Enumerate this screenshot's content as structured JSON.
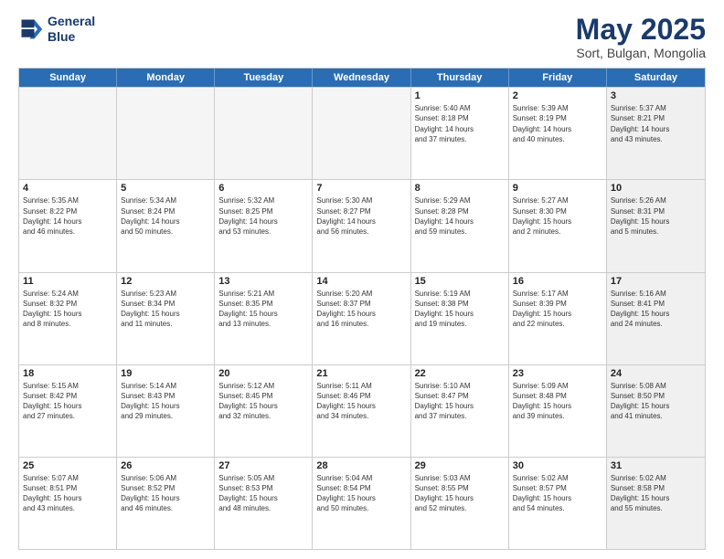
{
  "logo": {
    "line1": "General",
    "line2": "Blue"
  },
  "title": "May 2025",
  "subtitle": "Sort, Bulgan, Mongolia",
  "headers": [
    "Sunday",
    "Monday",
    "Tuesday",
    "Wednesday",
    "Thursday",
    "Friday",
    "Saturday"
  ],
  "rows": [
    [
      {
        "day": "",
        "lines": [],
        "empty": true
      },
      {
        "day": "",
        "lines": [],
        "empty": true
      },
      {
        "day": "",
        "lines": [],
        "empty": true
      },
      {
        "day": "",
        "lines": [],
        "empty": true
      },
      {
        "day": "1",
        "lines": [
          "Sunrise: 5:40 AM",
          "Sunset: 8:18 PM",
          "Daylight: 14 hours",
          "and 37 minutes."
        ],
        "empty": false,
        "shaded": false
      },
      {
        "day": "2",
        "lines": [
          "Sunrise: 5:39 AM",
          "Sunset: 8:19 PM",
          "Daylight: 14 hours",
          "and 40 minutes."
        ],
        "empty": false,
        "shaded": false
      },
      {
        "day": "3",
        "lines": [
          "Sunrise: 5:37 AM",
          "Sunset: 8:21 PM",
          "Daylight: 14 hours",
          "and 43 minutes."
        ],
        "empty": false,
        "shaded": true
      }
    ],
    [
      {
        "day": "4",
        "lines": [
          "Sunrise: 5:35 AM",
          "Sunset: 8:22 PM",
          "Daylight: 14 hours",
          "and 46 minutes."
        ],
        "empty": false,
        "shaded": false
      },
      {
        "day": "5",
        "lines": [
          "Sunrise: 5:34 AM",
          "Sunset: 8:24 PM",
          "Daylight: 14 hours",
          "and 50 minutes."
        ],
        "empty": false,
        "shaded": false
      },
      {
        "day": "6",
        "lines": [
          "Sunrise: 5:32 AM",
          "Sunset: 8:25 PM",
          "Daylight: 14 hours",
          "and 53 minutes."
        ],
        "empty": false,
        "shaded": false
      },
      {
        "day": "7",
        "lines": [
          "Sunrise: 5:30 AM",
          "Sunset: 8:27 PM",
          "Daylight: 14 hours",
          "and 56 minutes."
        ],
        "empty": false,
        "shaded": false
      },
      {
        "day": "8",
        "lines": [
          "Sunrise: 5:29 AM",
          "Sunset: 8:28 PM",
          "Daylight: 14 hours",
          "and 59 minutes."
        ],
        "empty": false,
        "shaded": false
      },
      {
        "day": "9",
        "lines": [
          "Sunrise: 5:27 AM",
          "Sunset: 8:30 PM",
          "Daylight: 15 hours",
          "and 2 minutes."
        ],
        "empty": false,
        "shaded": false
      },
      {
        "day": "10",
        "lines": [
          "Sunrise: 5:26 AM",
          "Sunset: 8:31 PM",
          "Daylight: 15 hours",
          "and 5 minutes."
        ],
        "empty": false,
        "shaded": true
      }
    ],
    [
      {
        "day": "11",
        "lines": [
          "Sunrise: 5:24 AM",
          "Sunset: 8:32 PM",
          "Daylight: 15 hours",
          "and 8 minutes."
        ],
        "empty": false,
        "shaded": false
      },
      {
        "day": "12",
        "lines": [
          "Sunrise: 5:23 AM",
          "Sunset: 8:34 PM",
          "Daylight: 15 hours",
          "and 11 minutes."
        ],
        "empty": false,
        "shaded": false
      },
      {
        "day": "13",
        "lines": [
          "Sunrise: 5:21 AM",
          "Sunset: 8:35 PM",
          "Daylight: 15 hours",
          "and 13 minutes."
        ],
        "empty": false,
        "shaded": false
      },
      {
        "day": "14",
        "lines": [
          "Sunrise: 5:20 AM",
          "Sunset: 8:37 PM",
          "Daylight: 15 hours",
          "and 16 minutes."
        ],
        "empty": false,
        "shaded": false
      },
      {
        "day": "15",
        "lines": [
          "Sunrise: 5:19 AM",
          "Sunset: 8:38 PM",
          "Daylight: 15 hours",
          "and 19 minutes."
        ],
        "empty": false,
        "shaded": false
      },
      {
        "day": "16",
        "lines": [
          "Sunrise: 5:17 AM",
          "Sunset: 8:39 PM",
          "Daylight: 15 hours",
          "and 22 minutes."
        ],
        "empty": false,
        "shaded": false
      },
      {
        "day": "17",
        "lines": [
          "Sunrise: 5:16 AM",
          "Sunset: 8:41 PM",
          "Daylight: 15 hours",
          "and 24 minutes."
        ],
        "empty": false,
        "shaded": true
      }
    ],
    [
      {
        "day": "18",
        "lines": [
          "Sunrise: 5:15 AM",
          "Sunset: 8:42 PM",
          "Daylight: 15 hours",
          "and 27 minutes."
        ],
        "empty": false,
        "shaded": false
      },
      {
        "day": "19",
        "lines": [
          "Sunrise: 5:14 AM",
          "Sunset: 8:43 PM",
          "Daylight: 15 hours",
          "and 29 minutes."
        ],
        "empty": false,
        "shaded": false
      },
      {
        "day": "20",
        "lines": [
          "Sunrise: 5:12 AM",
          "Sunset: 8:45 PM",
          "Daylight: 15 hours",
          "and 32 minutes."
        ],
        "empty": false,
        "shaded": false
      },
      {
        "day": "21",
        "lines": [
          "Sunrise: 5:11 AM",
          "Sunset: 8:46 PM",
          "Daylight: 15 hours",
          "and 34 minutes."
        ],
        "empty": false,
        "shaded": false
      },
      {
        "day": "22",
        "lines": [
          "Sunrise: 5:10 AM",
          "Sunset: 8:47 PM",
          "Daylight: 15 hours",
          "and 37 minutes."
        ],
        "empty": false,
        "shaded": false
      },
      {
        "day": "23",
        "lines": [
          "Sunrise: 5:09 AM",
          "Sunset: 8:48 PM",
          "Daylight: 15 hours",
          "and 39 minutes."
        ],
        "empty": false,
        "shaded": false
      },
      {
        "day": "24",
        "lines": [
          "Sunrise: 5:08 AM",
          "Sunset: 8:50 PM",
          "Daylight: 15 hours",
          "and 41 minutes."
        ],
        "empty": false,
        "shaded": true
      }
    ],
    [
      {
        "day": "25",
        "lines": [
          "Sunrise: 5:07 AM",
          "Sunset: 8:51 PM",
          "Daylight: 15 hours",
          "and 43 minutes."
        ],
        "empty": false,
        "shaded": false
      },
      {
        "day": "26",
        "lines": [
          "Sunrise: 5:06 AM",
          "Sunset: 8:52 PM",
          "Daylight: 15 hours",
          "and 46 minutes."
        ],
        "empty": false,
        "shaded": false
      },
      {
        "day": "27",
        "lines": [
          "Sunrise: 5:05 AM",
          "Sunset: 8:53 PM",
          "Daylight: 15 hours",
          "and 48 minutes."
        ],
        "empty": false,
        "shaded": false
      },
      {
        "day": "28",
        "lines": [
          "Sunrise: 5:04 AM",
          "Sunset: 8:54 PM",
          "Daylight: 15 hours",
          "and 50 minutes."
        ],
        "empty": false,
        "shaded": false
      },
      {
        "day": "29",
        "lines": [
          "Sunrise: 5:03 AM",
          "Sunset: 8:55 PM",
          "Daylight: 15 hours",
          "and 52 minutes."
        ],
        "empty": false,
        "shaded": false
      },
      {
        "day": "30",
        "lines": [
          "Sunrise: 5:02 AM",
          "Sunset: 8:57 PM",
          "Daylight: 15 hours",
          "and 54 minutes."
        ],
        "empty": false,
        "shaded": false
      },
      {
        "day": "31",
        "lines": [
          "Sunrise: 5:02 AM",
          "Sunset: 8:58 PM",
          "Daylight: 15 hours",
          "and 55 minutes."
        ],
        "empty": false,
        "shaded": true
      }
    ]
  ]
}
